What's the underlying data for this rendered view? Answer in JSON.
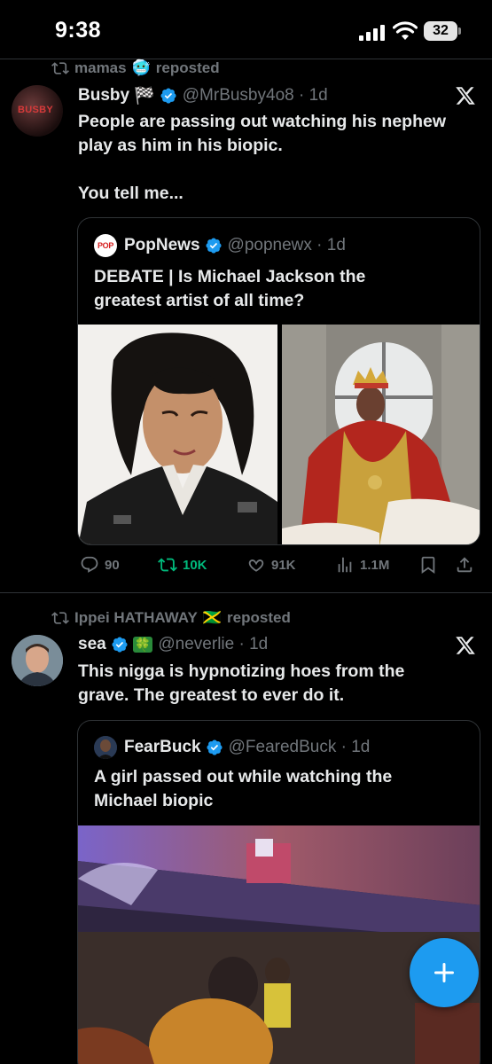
{
  "status_bar": {
    "time": "9:38",
    "battery": "32"
  },
  "tweets": [
    {
      "repost_by": "mamas",
      "repost_emoji": "🥶",
      "repost_suffix": "reposted",
      "name": "Busby",
      "name_emoji": "🏁",
      "handle": "@MrBusby4o8 · 1d",
      "avatar_text": "BUSBY",
      "text_line1": "People are passing out watching his nephew",
      "text_line2": "play as him in his biopic.",
      "text_line3": "You tell me...",
      "quote": {
        "name": "PopNews",
        "avatar_text": "POP",
        "handle": "@popnewx · 1d",
        "text_line1": "DEBATE | Is Michael Jackson the",
        "text_line2": "greatest artist of all time?"
      },
      "actions": {
        "replies": "90",
        "reposts": "10K",
        "likes": "91K",
        "views": "1.1M"
      }
    },
    {
      "repost_by": "Ippei HATHAWAY",
      "repost_emoji": "🇯🇲",
      "repost_suffix": "reposted",
      "name": "sea",
      "name_emoji": "🍀",
      "handle": "@neverlie · 1d",
      "text_line1": "This nigga is hypnotizing hoes from the",
      "text_line2": "grave. The greatest to ever do it.",
      "quote": {
        "name": "FearBuck",
        "handle": "@FearedBuck · 1d",
        "text_line1": "A girl passed out while watching the",
        "text_line2": "Michael biopic"
      }
    }
  ],
  "colors": {
    "background": "#000000",
    "text": "#e7e9ea",
    "muted": "#71767b",
    "verified": "#1d9bf0",
    "repost_active": "#00ba7c",
    "border": "#2f3336"
  },
  "icons": {
    "repost": "repost-icon",
    "verified": "verified-badge-icon",
    "x": "x-logo-icon",
    "reply": "reply-icon",
    "like": "heart-icon",
    "views": "views-icon",
    "bookmark": "bookmark-icon",
    "share": "share-icon",
    "compose": "plus-icon"
  }
}
